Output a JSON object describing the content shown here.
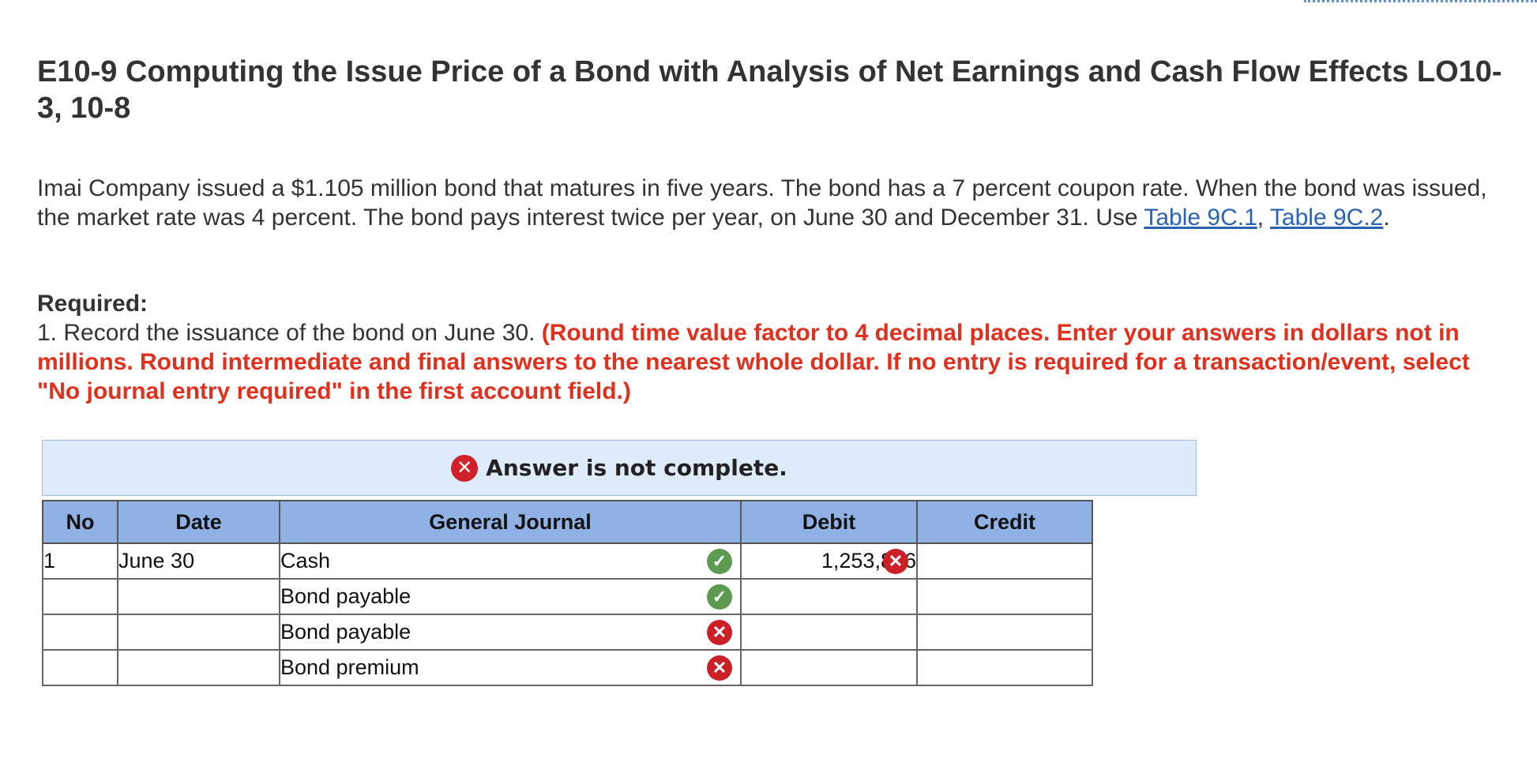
{
  "header": {
    "title": "E10-9 Computing the Issue Price of a Bond with Analysis of Net Earnings and Cash Flow Effects LO10-3, 10-8"
  },
  "intro": {
    "text": "Imai Company issued a $1.105 million bond that matures in five years. The bond has a 7 percent coupon rate. When the bond was issued, the market rate was 4 percent. The bond pays interest twice per year, on June 30 and December 31. Use ",
    "link1": "Table 9C.1",
    "sep": ", ",
    "link2": "Table 9C.2",
    "end": "."
  },
  "required": {
    "label": "Required:",
    "instruction": "1. Record the issuance of the bond on June 30. ",
    "note": "(Round time value factor to 4 decimal places. Enter your answers in dollars not in millions. Round intermediate and final answers to the nearest whole dollar. If no entry is required for a transaction/event, select \"No journal entry required\" in the first account field.)"
  },
  "banner": {
    "icon": "x-circle-icon",
    "text": "Answer is not complete."
  },
  "journal": {
    "headers": [
      "No",
      "Date",
      "General Journal",
      "Debit",
      "Credit"
    ],
    "rows": [
      {
        "no": "1",
        "date": "June 30",
        "account": "Cash",
        "account_status": "correct",
        "debit": "1,253,886",
        "debit_status": "incorrect",
        "credit": ""
      },
      {
        "no": "",
        "date": "",
        "account": "Bond payable",
        "account_status": "correct",
        "debit": "",
        "credit": ""
      },
      {
        "no": "",
        "date": "",
        "account": "Bond payable",
        "account_status": "incorrect",
        "debit": "",
        "credit": ""
      },
      {
        "no": "",
        "date": "",
        "account": "Bond premium",
        "account_status": "incorrect",
        "debit": "",
        "credit": ""
      }
    ]
  },
  "colors": {
    "error_red": "#e0301e",
    "check_green": "#5c9a50",
    "x_red": "#cc2027",
    "header_blue": "#8fb1e4",
    "banner_blue": "#ddebfa",
    "link_blue": "#2a63b4"
  }
}
